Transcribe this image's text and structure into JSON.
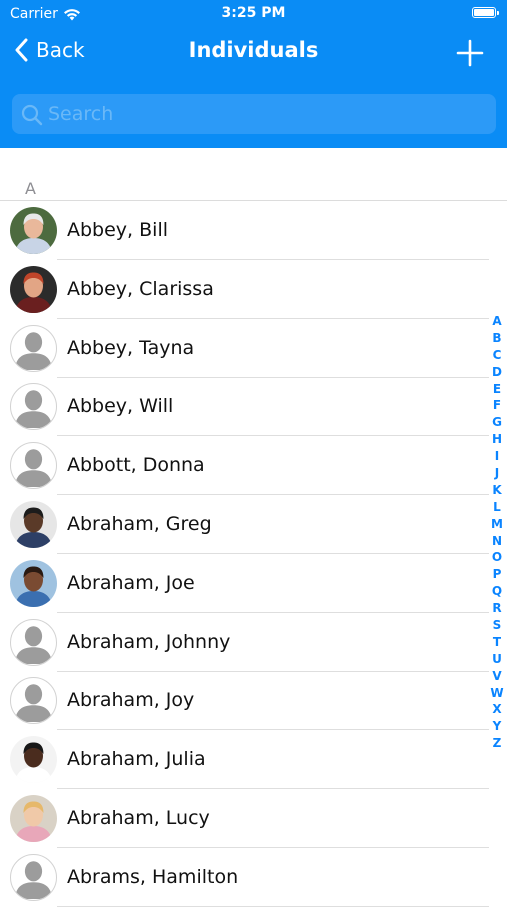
{
  "status_bar": {
    "carrier": "Carrier",
    "time": "3:25 PM"
  },
  "nav": {
    "back_label": "Back",
    "title": "Individuals",
    "add_icon": "plus-icon"
  },
  "search": {
    "placeholder": "Search",
    "value": ""
  },
  "colors": {
    "header": "#0a8cf5",
    "accent": "#0a84ff"
  },
  "section": {
    "letter": "A"
  },
  "contacts": [
    {
      "name": "Abbey, Bill",
      "avatar": "photo"
    },
    {
      "name": "Abbey, Clarissa",
      "avatar": "photo"
    },
    {
      "name": "Abbey, Tayna",
      "avatar": "placeholder"
    },
    {
      "name": "Abbey, Will",
      "avatar": "placeholder"
    },
    {
      "name": "Abbott, Donna",
      "avatar": "placeholder"
    },
    {
      "name": "Abraham, Greg",
      "avatar": "photo"
    },
    {
      "name": "Abraham, Joe",
      "avatar": "photo"
    },
    {
      "name": "Abraham, Johnny",
      "avatar": "placeholder"
    },
    {
      "name": "Abraham, Joy",
      "avatar": "placeholder"
    },
    {
      "name": "Abraham, Julia",
      "avatar": "photo"
    },
    {
      "name": "Abraham, Lucy",
      "avatar": "photo"
    },
    {
      "name": "Abrams, Hamilton",
      "avatar": "placeholder"
    }
  ],
  "index_letters": [
    "A",
    "B",
    "C",
    "D",
    "E",
    "F",
    "G",
    "H",
    "I",
    "J",
    "K",
    "L",
    "M",
    "N",
    "O",
    "P",
    "Q",
    "R",
    "S",
    "T",
    "U",
    "V",
    "W",
    "X",
    "Y",
    "Z"
  ]
}
